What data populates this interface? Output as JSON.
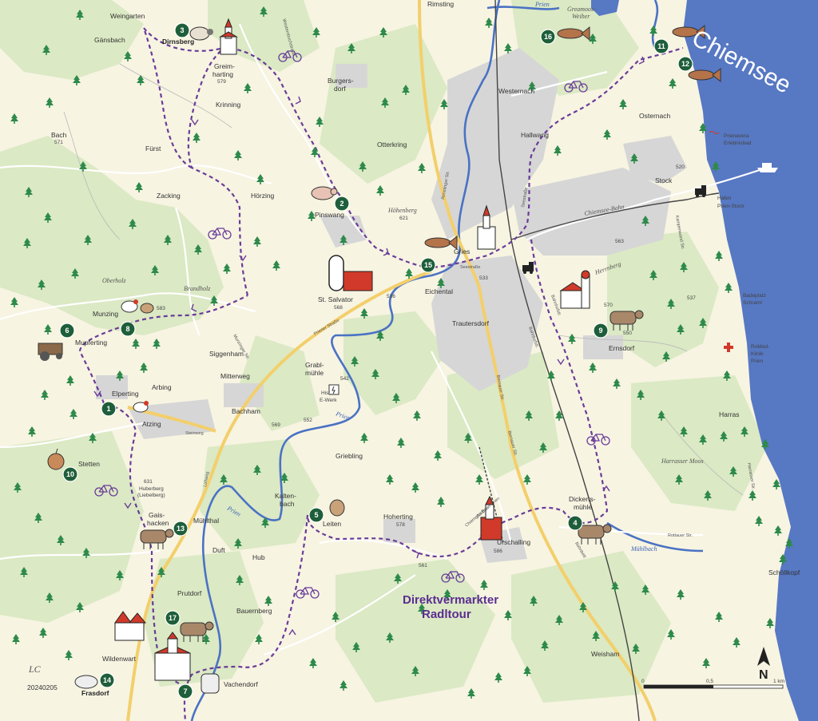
{
  "map": {
    "title_line1": "Direktvermarkter",
    "title_line2": "Radltour",
    "lake_name": "Chiemsee",
    "credit": "LC",
    "date_code": "20240205",
    "scale": {
      "zero": "0",
      "half": "0,5",
      "one": "1 km"
    },
    "north": "N"
  },
  "places": [
    {
      "id": "rimsting",
      "label": "Rimsting"
    },
    {
      "id": "weingarten",
      "label": "Weingarten"
    },
    {
      "id": "gaensbach",
      "label": "Gänsbach"
    },
    {
      "id": "dirnsberg",
      "label": "Dirnsberg"
    },
    {
      "id": "greimharting1",
      "label": "Greim-"
    },
    {
      "id": "greimharting2",
      "label": "harting"
    },
    {
      "id": "greimharting_alt",
      "label": "579"
    },
    {
      "id": "burgersdorf1",
      "label": "Burgers-"
    },
    {
      "id": "burgersdorf2",
      "label": "dorf"
    },
    {
      "id": "krinning",
      "label": "Krinning"
    },
    {
      "id": "westernach",
      "label": "Westernach"
    },
    {
      "id": "osternach",
      "label": "Osternach"
    },
    {
      "id": "bach",
      "label": "Bach"
    },
    {
      "id": "bach_alt",
      "label": "571"
    },
    {
      "id": "fuerst",
      "label": "Fürst"
    },
    {
      "id": "otterkring",
      "label": "Otterkring"
    },
    {
      "id": "hallwang",
      "label": "Hallwang"
    },
    {
      "id": "zacking",
      "label": "Zacking"
    },
    {
      "id": "hoerzing",
      "label": "Hörzing"
    },
    {
      "id": "pinswang",
      "label": "Pinswang"
    },
    {
      "id": "stock",
      "label": "Stock"
    },
    {
      "id": "stock_alt",
      "label": "520"
    },
    {
      "id": "hafen1",
      "label": "Hafen"
    },
    {
      "id": "hafen2",
      "label": "Prien-Stock"
    },
    {
      "id": "prienavera1",
      "label": "Prienavera"
    },
    {
      "id": "prienavera2",
      "label": "Erlebnisbad"
    },
    {
      "id": "gries",
      "label": "Gries"
    },
    {
      "id": "gries_alt",
      "label": "533"
    },
    {
      "id": "alt563",
      "label": "563"
    },
    {
      "id": "alt621",
      "label": "621"
    },
    {
      "id": "stsalvator",
      "label": "St. Salvator"
    },
    {
      "id": "stsalvator_alt",
      "label": "568"
    },
    {
      "id": "eichental",
      "label": "Eichental"
    },
    {
      "id": "alt536",
      "label": "536"
    },
    {
      "id": "trautersdorf",
      "label": "Trautersdorf"
    },
    {
      "id": "alt570",
      "label": "570"
    },
    {
      "id": "alt550",
      "label": "550"
    },
    {
      "id": "alt537",
      "label": "537"
    },
    {
      "id": "badeplatz1",
      "label": "Badeplatz"
    },
    {
      "id": "badeplatz2",
      "label": "Schraml"
    },
    {
      "id": "munzing",
      "label": "Munzing"
    },
    {
      "id": "alt583",
      "label": "583"
    },
    {
      "id": "mupferting",
      "label": "Mupferting"
    },
    {
      "id": "siggenham",
      "label": "Siggenham"
    },
    {
      "id": "mitterweg",
      "label": "Mitterweg"
    },
    {
      "id": "ernsdorf",
      "label": "Ernsdorf"
    },
    {
      "id": "romed1",
      "label": "RoMed-"
    },
    {
      "id": "romed2",
      "label": "Klinik"
    },
    {
      "id": "romed3",
      "label": "Prien"
    },
    {
      "id": "grabl1",
      "label": "Grabl-"
    },
    {
      "id": "grabl2",
      "label": "mühle"
    },
    {
      "id": "alt542",
      "label": "542"
    },
    {
      "id": "ewerk1",
      "label": "Hist."
    },
    {
      "id": "ewerk2",
      "label": "E-Werk"
    },
    {
      "id": "elperting",
      "label": "Elperting"
    },
    {
      "id": "arbing",
      "label": "Arbing"
    },
    {
      "id": "bachham",
      "label": "Bachham"
    },
    {
      "id": "atzing",
      "label": "Atzing"
    },
    {
      "id": "alt569",
      "label": "569"
    },
    {
      "id": "alt552",
      "label": "552"
    },
    {
      "id": "harras",
      "label": "Harras"
    },
    {
      "id": "griebling",
      "label": "Griebling"
    },
    {
      "id": "stetten",
      "label": "Stetten"
    },
    {
      "id": "alt631",
      "label": "631"
    },
    {
      "id": "huberberg1",
      "label": "Huberberg"
    },
    {
      "id": "huberberg2",
      "label": "(Liebelberg)"
    },
    {
      "id": "kaltenbach1",
      "label": "Kalten-"
    },
    {
      "id": "kaltenbach2",
      "label": "bach"
    },
    {
      "id": "dickertsmuehle1",
      "label": "Dickerts-"
    },
    {
      "id": "dickertsmuehle2",
      "label": "mühle"
    },
    {
      "id": "gaishacken1",
      "label": "Gais-"
    },
    {
      "id": "gaishacken2",
      "label": "hacken"
    },
    {
      "id": "muehlthal",
      "label": "Mühlthal"
    },
    {
      "id": "leiten",
      "label": "Leiten"
    },
    {
      "id": "hoherting",
      "label": "Hoherting"
    },
    {
      "id": "alt578",
      "label": "578"
    },
    {
      "id": "urschalling",
      "label": "Urschalling"
    },
    {
      "id": "alt586",
      "label": "586"
    },
    {
      "id": "duft",
      "label": "Duft"
    },
    {
      "id": "hub",
      "label": "Hub"
    },
    {
      "id": "alt561",
      "label": "561"
    },
    {
      "id": "schoellkopf",
      "label": "Schöllkopf"
    },
    {
      "id": "prutdorf",
      "label": "Prutdorf"
    },
    {
      "id": "bauernberg",
      "label": "Bauernberg"
    },
    {
      "id": "weisham",
      "label": "Weisham"
    },
    {
      "id": "wildenwart",
      "label": "Wildenwart"
    },
    {
      "id": "vachendorf",
      "label": "Vachendorf"
    },
    {
      "id": "frasdorf",
      "label": "Frasdorf"
    }
  ],
  "area_labels": [
    {
      "id": "greamoos1",
      "label": "Greamoos-"
    },
    {
      "id": "greamoos2",
      "label": "Weiher"
    },
    {
      "id": "hoehenberg",
      "label": "Höhenberg"
    },
    {
      "id": "oberholz",
      "label": "Oberholz"
    },
    {
      "id": "brandholz",
      "label": "Brandholz"
    },
    {
      "id": "herrnberg",
      "label": "Herrnberg"
    },
    {
      "id": "harrassermoos",
      "label": "Harrasser Moos"
    }
  ],
  "rivers": [
    {
      "id": "prien_top",
      "label": "Prien"
    },
    {
      "id": "prien_mid",
      "label": "Prien"
    },
    {
      "id": "prien_low",
      "label": "Prien"
    },
    {
      "id": "muehlbach",
      "label": "Mühlbach"
    }
  ],
  "roads": [
    {
      "id": "westernbuch",
      "label": "Westernbuchstraße"
    },
    {
      "id": "chiemseebahn",
      "label": "Chiemsee-Bahn"
    },
    {
      "id": "priener",
      "label": "Priener Straße"
    },
    {
      "id": "bernauer",
      "label": "Bernauer Str."
    },
    {
      "id": "seestrasse",
      "label": "Seestraße"
    },
    {
      "id": "harrasser",
      "label": "Harrasser Str."
    },
    {
      "id": "kampenwand",
      "label": "Kampenwand Str."
    },
    {
      "id": "bahnhof",
      "label": "Bahnhofstr."
    },
    {
      "id": "bahn",
      "label": "Chiemgau-Bahn"
    },
    {
      "id": "aschau",
      "label": "Aschau - Prien"
    },
    {
      "id": "steinweg",
      "label": "Steinweg"
    },
    {
      "id": "lohweg",
      "label": "Lohweg"
    },
    {
      "id": "munzinger",
      "label": "Munzinger Str."
    },
    {
      "id": "bahnhofstr2",
      "label": "Bahnhofstr."
    },
    {
      "id": "rimstinger",
      "label": "Rimstinger Str."
    },
    {
      "id": "bernauer2",
      "label": "Bernauer Str."
    },
    {
      "id": "seestr",
      "label": "Seestraße"
    },
    {
      "id": "rott",
      "label": "Rottauer Str."
    },
    {
      "id": "bahnbett",
      "label": "Bahnbett"
    }
  ],
  "stops": [
    {
      "n": "1"
    },
    {
      "n": "2"
    },
    {
      "n": "3"
    },
    {
      "n": "4"
    },
    {
      "n": "5"
    },
    {
      "n": "6"
    },
    {
      "n": "7"
    },
    {
      "n": "8"
    },
    {
      "n": "9"
    },
    {
      "n": "10"
    },
    {
      "n": "11"
    },
    {
      "n": "12"
    },
    {
      "n": "13"
    },
    {
      "n": "14"
    },
    {
      "n": "15"
    },
    {
      "n": "16"
    },
    {
      "n": "17"
    }
  ],
  "colors": {
    "background": "#f7f4e2",
    "forest": "#dbe9c4",
    "water": "#5778c3",
    "route": "#6a3c98",
    "stop": "#1e5e3a",
    "title": "#5a2d91",
    "settlement": "#d6d6d6",
    "main_road": "#f3cf6b"
  }
}
